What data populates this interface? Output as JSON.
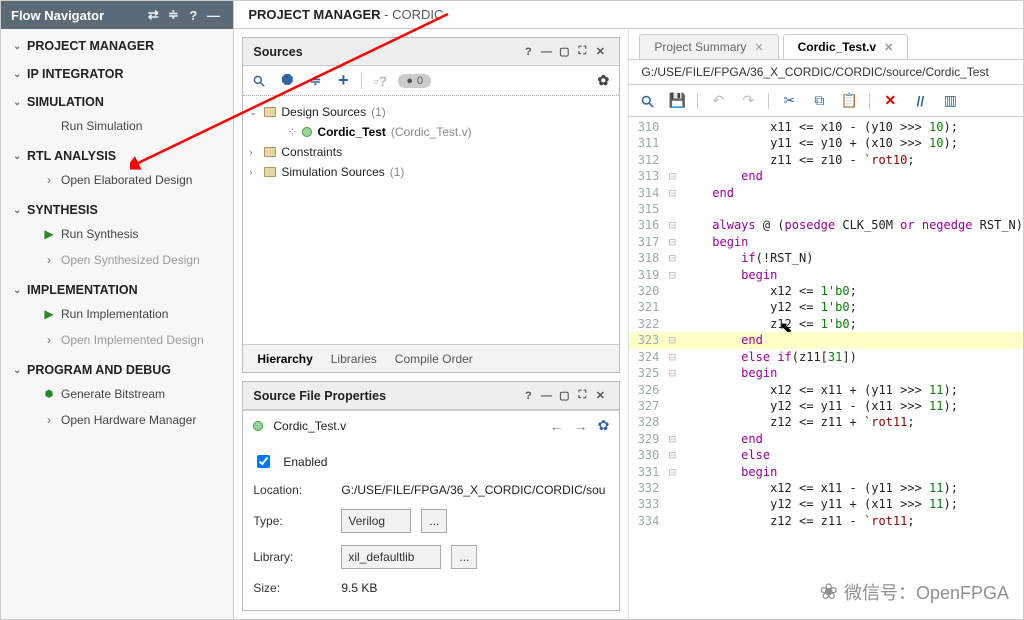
{
  "nav": {
    "title": "Flow Navigator",
    "sections": [
      {
        "label": "PROJECT MANAGER",
        "items": []
      },
      {
        "label": "IP INTEGRATOR",
        "items": []
      },
      {
        "label": "SIMULATION",
        "items": [
          {
            "label": "Run Simulation",
            "icon": "",
            "dis": false
          }
        ]
      },
      {
        "label": "RTL ANALYSIS",
        "items": [
          {
            "label": "Open Elaborated Design",
            "icon": "›",
            "dis": false
          }
        ]
      },
      {
        "label": "SYNTHESIS",
        "items": [
          {
            "label": "Run Synthesis",
            "icon": "▶",
            "dis": false
          },
          {
            "label": "Open Synthesized Design",
            "icon": "›",
            "dis": true
          }
        ]
      },
      {
        "label": "IMPLEMENTATION",
        "items": [
          {
            "label": "Run Implementation",
            "icon": "▶",
            "dis": false
          },
          {
            "label": "Open Implemented Design",
            "icon": "›",
            "dis": true
          }
        ]
      },
      {
        "label": "PROGRAM AND DEBUG",
        "items": [
          {
            "label": "Generate Bitstream",
            "icon": "⬢",
            "dis": false
          },
          {
            "label": "Open Hardware Manager",
            "icon": "›",
            "dis": false
          }
        ]
      }
    ]
  },
  "header": {
    "title": "PROJECT MANAGER",
    "project": "CORDIC"
  },
  "sources": {
    "title": "Sources",
    "pill": "0",
    "tree": {
      "design": {
        "label": "Design Sources",
        "count": "(1)"
      },
      "top": {
        "name": "Cordic_Test",
        "file": "(Cordic_Test.v)"
      },
      "constraints": {
        "label": "Constraints"
      },
      "sim": {
        "label": "Simulation Sources",
        "count": "(1)"
      }
    },
    "tabs": [
      "Hierarchy",
      "Libraries",
      "Compile Order"
    ]
  },
  "props": {
    "title": "Source File Properties",
    "file": "Cordic_Test.v",
    "enabled_label": "Enabled",
    "rows": {
      "location": {
        "label": "Location:",
        "value": "G:/USE/FILE/FPGA/36_X_CORDIC/CORDIC/sou"
      },
      "type": {
        "label": "Type:",
        "value": "Verilog"
      },
      "library": {
        "label": "Library:",
        "value": "xil_defaultlib"
      },
      "size": {
        "label": "Size:",
        "value": "9.5 KB"
      }
    }
  },
  "editor": {
    "tabs": [
      {
        "label": "Project Summary",
        "active": false,
        "closable": true
      },
      {
        "label": "Cordic_Test.v",
        "active": true,
        "closable": true
      }
    ],
    "path": "G:/USE/FILE/FPGA/36_X_CORDIC/CORDIC/source/Cordic_Test",
    "lines": [
      {
        "n": 310,
        "g": "",
        "ind": 3,
        "raw": "x11 <= x10 - (y10 >>> 10);"
      },
      {
        "n": 311,
        "g": "",
        "ind": 3,
        "raw": "y11 <= y10 + (x10 >>> 10);"
      },
      {
        "n": 312,
        "g": "",
        "ind": 3,
        "raw": "z11 <= z10 - `rot10;"
      },
      {
        "n": 313,
        "g": "⊟",
        "ind": 2,
        "raw": "end"
      },
      {
        "n": 314,
        "g": "⊟",
        "ind": 1,
        "raw": "end"
      },
      {
        "n": 315,
        "g": "",
        "ind": 0,
        "raw": ""
      },
      {
        "n": 316,
        "g": "⊟",
        "ind": 1,
        "raw": "always @ (posedge CLK_50M or negedge RST_N)"
      },
      {
        "n": 317,
        "g": "⊟",
        "ind": 1,
        "raw": "begin"
      },
      {
        "n": 318,
        "g": "⊟",
        "ind": 2,
        "raw": "if(!RST_N)"
      },
      {
        "n": 319,
        "g": "⊟",
        "ind": 2,
        "raw": "begin"
      },
      {
        "n": 320,
        "g": "",
        "ind": 3,
        "raw": "x12 <= 1'b0;"
      },
      {
        "n": 321,
        "g": "",
        "ind": 3,
        "raw": "y12 <= 1'b0;"
      },
      {
        "n": 322,
        "g": "",
        "ind": 3,
        "raw": "z12 <= 1'b0;"
      },
      {
        "n": 323,
        "g": "⊟",
        "ind": 2,
        "raw": "end",
        "hl": true
      },
      {
        "n": 324,
        "g": "⊟",
        "ind": 2,
        "raw": "else if(z11[31])"
      },
      {
        "n": 325,
        "g": "⊟",
        "ind": 2,
        "raw": "begin"
      },
      {
        "n": 326,
        "g": "",
        "ind": 3,
        "raw": "x12 <= x11 + (y11 >>> 11);"
      },
      {
        "n": 327,
        "g": "",
        "ind": 3,
        "raw": "y12 <= y11 - (x11 >>> 11);"
      },
      {
        "n": 328,
        "g": "",
        "ind": 3,
        "raw": "z12 <= z11 + `rot11;"
      },
      {
        "n": 329,
        "g": "⊟",
        "ind": 2,
        "raw": "end"
      },
      {
        "n": 330,
        "g": "⊟",
        "ind": 2,
        "raw": "else"
      },
      {
        "n": 331,
        "g": "⊟",
        "ind": 2,
        "raw": "begin"
      },
      {
        "n": 332,
        "g": "",
        "ind": 3,
        "raw": "x12 <= x11 - (y11 >>> 11);"
      },
      {
        "n": 333,
        "g": "",
        "ind": 3,
        "raw": "y12 <= y11 + (x11 >>> 11);"
      },
      {
        "n": 334,
        "g": "",
        "ind": 3,
        "raw": "z12 <= z11 - `rot11;"
      }
    ]
  },
  "watermark": "微信号：OpenFPGA"
}
